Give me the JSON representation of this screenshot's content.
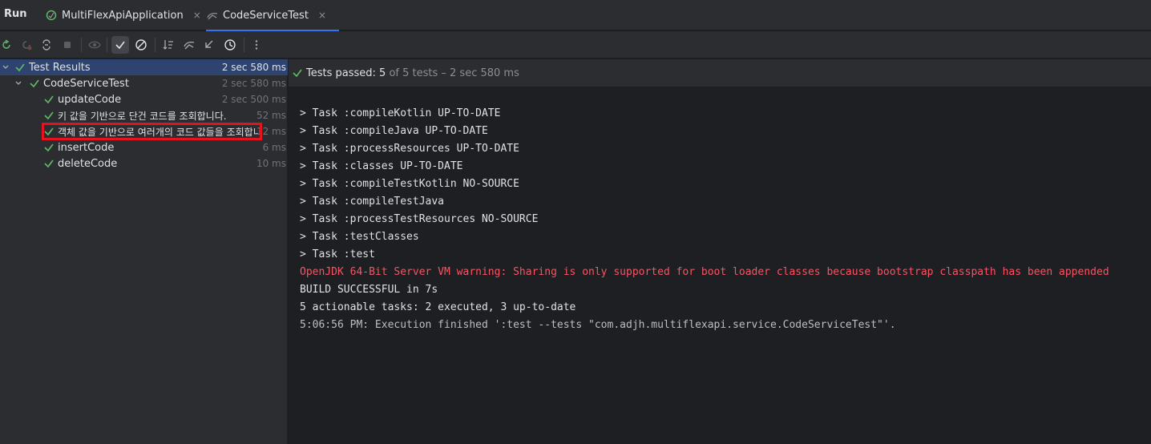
{
  "tabbar": {
    "run_label": "Run",
    "tabs": [
      {
        "label": "MultiFlexApiApplication",
        "icon": "spring-icon",
        "close": "×"
      },
      {
        "label": "CodeServiceTest",
        "icon": "test-icon",
        "close": "×"
      }
    ]
  },
  "tree": {
    "rows": [
      {
        "label": "Test Results",
        "duration": "2 sec 580 ms",
        "level": 0
      },
      {
        "label": "CodeServiceTest",
        "duration": "2 sec 580 ms",
        "level": 1
      },
      {
        "label": "updateCode",
        "duration": "2 sec 500 ms",
        "level": 2
      },
      {
        "label": "키 값을 기반으로 단건 코드를 조회합니다.",
        "duration": "52 ms",
        "level": 2
      },
      {
        "label": "객체 값을 기반으로 여러개의 코드 값들을 조회합니다.",
        "duration": "12 ms",
        "level": 2
      },
      {
        "label": "insertCode",
        "duration": "6 ms",
        "level": 2
      },
      {
        "label": "deleteCode",
        "duration": "10 ms",
        "level": 2
      }
    ]
  },
  "status": {
    "prefix": "Tests passed: ",
    "passed": "5",
    "suffix": " of 5 tests – 2 sec 580 ms"
  },
  "console": {
    "lines": [
      "> Task :compileKotlin UP-TO-DATE",
      "> Task :compileJava UP-TO-DATE",
      "> Task :processResources UP-TO-DATE",
      "> Task :classes UP-TO-DATE",
      "> Task :compileTestKotlin NO-SOURCE",
      "> Task :compileTestJava",
      "> Task :processTestResources NO-SOURCE",
      "> Task :testClasses",
      "> Task :test",
      "OpenJDK 64-Bit Server VM warning: Sharing is only supported for boot loader classes because bootstrap classpath has been appended",
      "BUILD SUCCESSFUL in 7s",
      "5 actionable tasks: 2 executed, 3 up-to-date",
      "5:06:56 PM: Execution finished ':test --tests \"com.adjh.multiflexapi.service.CodeServiceTest\"'."
    ]
  },
  "colors": {
    "accent": "#3574f0",
    "pass": "#5fb865",
    "error": "#f75464",
    "highlight": "#e8121f"
  }
}
